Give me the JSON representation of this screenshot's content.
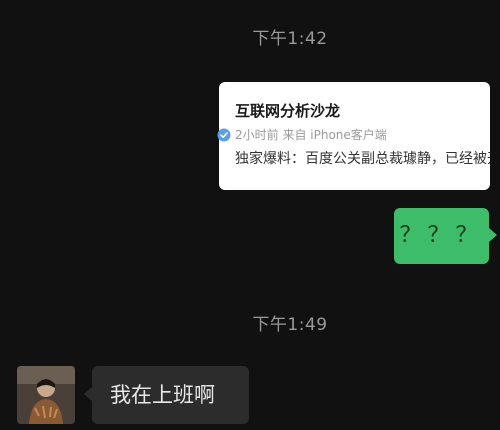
{
  "chat": {
    "timestamps": [
      "下午1:42",
      "下午1:49"
    ],
    "shared_card": {
      "title": "互联网分析沙龙",
      "meta": "2小时前  来自 iPhone客户端",
      "preview": "独家爆料：百度公关副总裁璩静，已经被开"
    },
    "messages": [
      {
        "side": "right",
        "text": "？？？"
      },
      {
        "side": "left",
        "text": "我在上班啊"
      }
    ]
  },
  "colors": {
    "background": "#111111",
    "outgoing_bubble": "#3dbd6a",
    "incoming_bubble": "#2c2c2c",
    "card_background": "#ffffff",
    "timestamp_text": "#9a9a9a"
  },
  "icons": {
    "verified": "verified-badge-icon",
    "avatar": "user-avatar"
  }
}
